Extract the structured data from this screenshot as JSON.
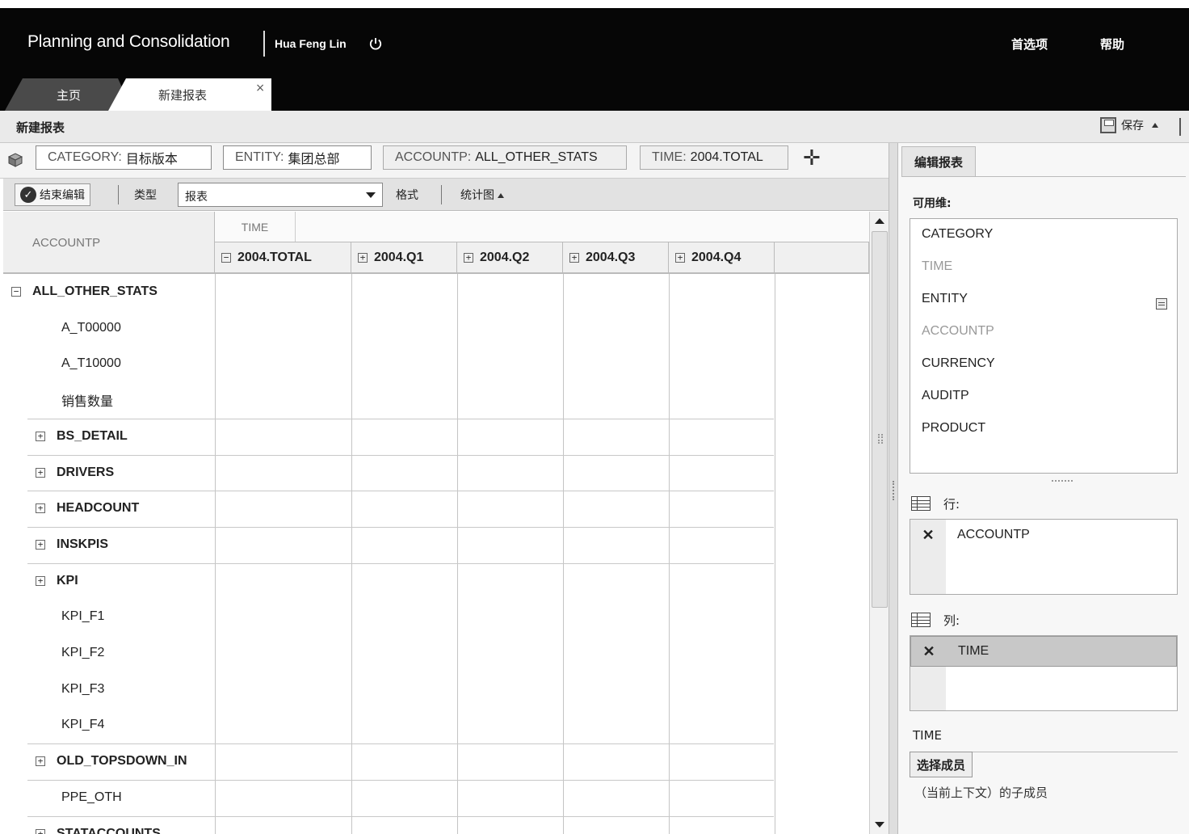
{
  "header": {
    "app_title": "Planning and Consolidation",
    "user_name": "Hua Feng Lin",
    "preferences": "首选项",
    "help": "帮助"
  },
  "tabs": [
    {
      "label": "主页"
    },
    {
      "label": "新建报表",
      "close": "×"
    }
  ],
  "page": {
    "title": "新建报表",
    "save_label": "保存"
  },
  "pov": [
    {
      "dim": "CATEGORY:",
      "value": "目标版本"
    },
    {
      "dim": "ENTITY:",
      "value": "集团总部"
    },
    {
      "dim": "ACCOUNTP:",
      "value": "ALL_OTHER_STATS"
    },
    {
      "dim": "TIME:",
      "value": "2004.TOTAL"
    }
  ],
  "pov_add": "✛",
  "toolbar": {
    "end_edit": "结束编辑",
    "type_label": "类型",
    "type_value": "报表",
    "format_label": "格式",
    "chart_label": "统计图"
  },
  "grid": {
    "row_dim": "ACCOUNTP",
    "col_dim": "TIME",
    "columns": [
      {
        "label": "2004.TOTAL",
        "pm": "⊟"
      },
      {
        "label": "2004.Q1",
        "pm": "⊞"
      },
      {
        "label": "2004.Q2",
        "pm": "⊞"
      },
      {
        "label": "2004.Q3",
        "pm": "⊞"
      },
      {
        "label": "2004.Q4",
        "pm": "⊞"
      }
    ],
    "rows": [
      {
        "label": "ALL_OTHER_STATS",
        "pm": "⊟",
        "level": 0,
        "bold": true
      },
      {
        "label": "A_T00000",
        "pm": "",
        "level": 2,
        "bold": false
      },
      {
        "label": "A_T10000",
        "pm": "",
        "level": 2,
        "bold": false
      },
      {
        "label": "销售数量",
        "pm": "",
        "level": 2,
        "bold": false
      },
      {
        "label": "BS_DETAIL",
        "pm": "⊞",
        "level": 1,
        "bold": true
      },
      {
        "label": "DRIVERS",
        "pm": "⊞",
        "level": 1,
        "bold": true
      },
      {
        "label": "HEADCOUNT",
        "pm": "⊞",
        "level": 1,
        "bold": true
      },
      {
        "label": "INSKPIS",
        "pm": "⊞",
        "level": 1,
        "bold": true
      },
      {
        "label": "KPI",
        "pm": "⊞",
        "level": 1,
        "bold": true
      },
      {
        "label": "KPI_F1",
        "pm": "",
        "level": 2,
        "bold": false
      },
      {
        "label": "KPI_F2",
        "pm": "",
        "level": 2,
        "bold": false
      },
      {
        "label": "KPI_F3",
        "pm": "",
        "level": 2,
        "bold": false
      },
      {
        "label": "KPI_F4",
        "pm": "",
        "level": 2,
        "bold": false
      },
      {
        "label": "OLD_TOPSDOWN_IN",
        "pm": "⊞",
        "level": 1,
        "bold": true
      },
      {
        "label": "PPE_OTH",
        "pm": "",
        "level": 2,
        "bold": false
      },
      {
        "label": "STATACCOUNTS",
        "pm": "⊞",
        "level": 1,
        "bold": true
      }
    ]
  },
  "side": {
    "tab": "编辑报表",
    "available_label": "可用维:",
    "available": [
      {
        "label": "CATEGORY",
        "muted": false
      },
      {
        "label": "TIME",
        "muted": true
      },
      {
        "label": "ENTITY",
        "muted": false
      },
      {
        "label": "ACCOUNTP",
        "muted": true
      },
      {
        "label": "CURRENCY",
        "muted": false
      },
      {
        "label": "AUDITP",
        "muted": false
      },
      {
        "label": "PRODUCT",
        "muted": false
      }
    ],
    "rows_label": "行:",
    "rows_item": "ACCOUNTP",
    "cols_label": "列:",
    "cols_item": "TIME",
    "remove_symbol": "✕",
    "time_section": "TIME",
    "select_member": "选择成员",
    "children_note": "（当前上下文）的子成员"
  }
}
